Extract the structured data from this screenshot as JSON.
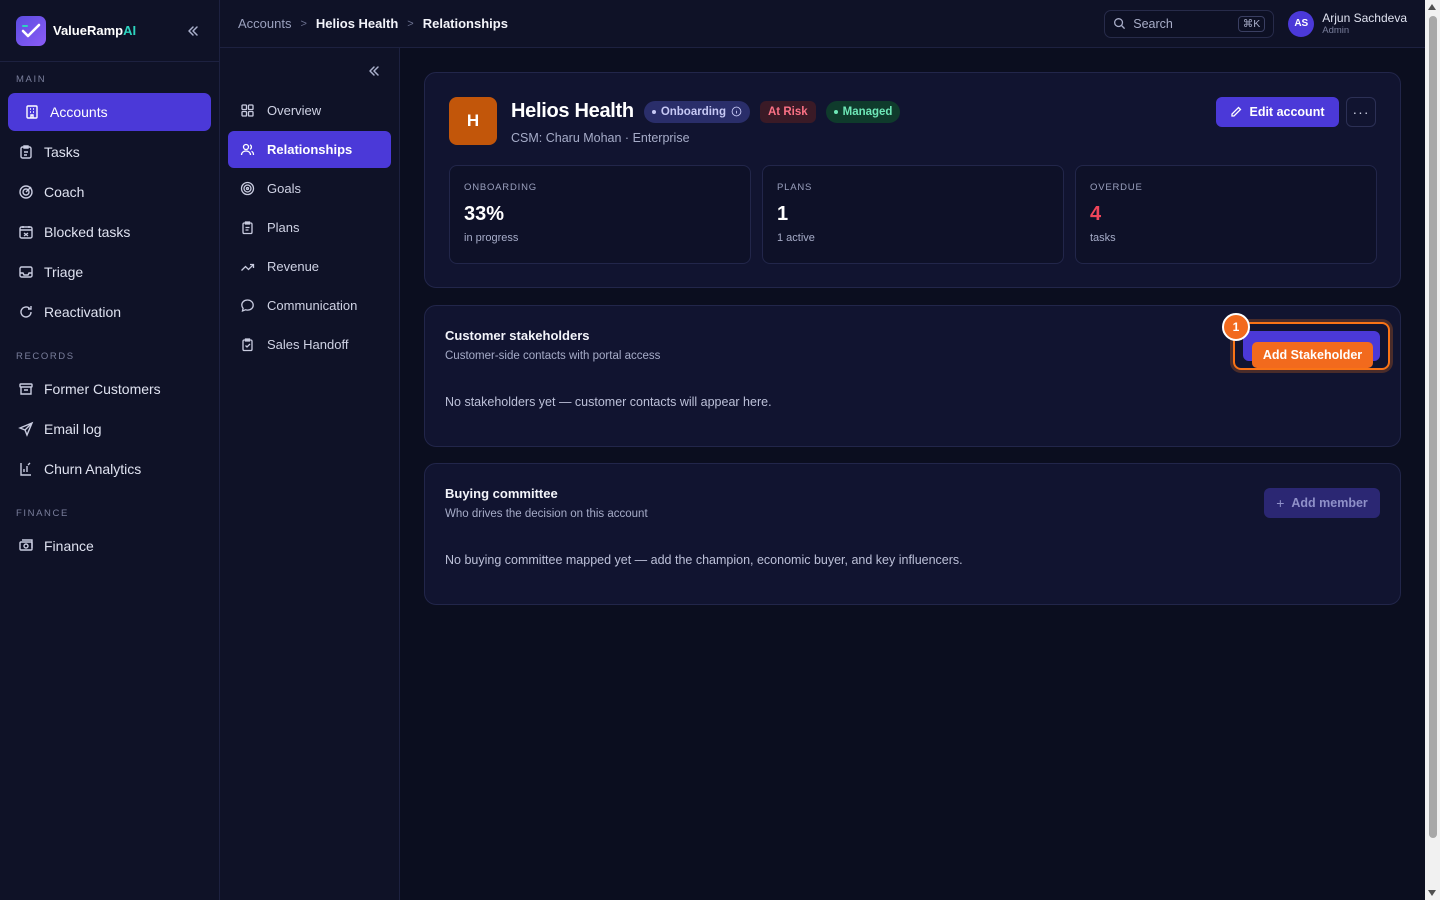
{
  "brand": {
    "name": "ValueRamp",
    "suffix": "AI"
  },
  "sidebar": {
    "sections": [
      {
        "label": "MAIN",
        "items": [
          {
            "label": "Accounts",
            "icon": "building-icon",
            "active": true
          },
          {
            "label": "Tasks",
            "icon": "clipboard-icon"
          },
          {
            "label": "Coach",
            "icon": "target-icon"
          },
          {
            "label": "Blocked tasks",
            "icon": "calendar-x-icon"
          },
          {
            "label": "Triage",
            "icon": "inbox-icon"
          },
          {
            "label": "Reactivation",
            "icon": "refresh-icon"
          }
        ]
      },
      {
        "label": "RECORDS",
        "items": [
          {
            "label": "Former Customers",
            "icon": "archive-icon"
          },
          {
            "label": "Email log",
            "icon": "send-icon"
          },
          {
            "label": "Churn Analytics",
            "icon": "chart-icon"
          }
        ]
      },
      {
        "label": "FINANCE",
        "items": [
          {
            "label": "Finance",
            "icon": "banknote-icon"
          }
        ]
      }
    ]
  },
  "breadcrumb": [
    "Accounts",
    "Helios Health",
    "Relationships"
  ],
  "search": {
    "placeholder": "Search",
    "shortcut": "⌘K"
  },
  "user": {
    "initials": "AS",
    "name": "Arjun Sachdeva",
    "role": "Admin"
  },
  "subnav": {
    "items": [
      {
        "label": "Overview",
        "icon": "grid-icon"
      },
      {
        "label": "Relationships",
        "icon": "users-icon",
        "active": true
      },
      {
        "label": "Goals",
        "icon": "target-icon"
      },
      {
        "label": "Plans",
        "icon": "clipboard-icon"
      },
      {
        "label": "Revenue",
        "icon": "trending-up-icon"
      },
      {
        "label": "Communication",
        "icon": "message-icon"
      },
      {
        "label": "Sales Handoff",
        "icon": "clipboard-check-icon"
      }
    ]
  },
  "account": {
    "initial": "H",
    "name": "Helios Health",
    "badges": {
      "onboarding": "Onboarding",
      "risk": "At Risk",
      "managed": "Managed"
    },
    "subtitle": "CSM: Charu Mohan · Enterprise",
    "edit_label": "Edit account",
    "more_label": "···",
    "stats": [
      {
        "label": "ONBOARDING",
        "value": "33%",
        "caption": "in progress"
      },
      {
        "label": "PLANS",
        "value": "1",
        "caption": "1 active"
      },
      {
        "label": "OVERDUE",
        "value": "4",
        "caption": "tasks"
      }
    ]
  },
  "stakeholders": {
    "title": "Customer stakeholders",
    "subtitle": "Customer-side contacts with portal access",
    "button_label": "Add Stakeholder",
    "marker": "1",
    "empty": "No stakeholders yet — customer contacts will appear here."
  },
  "buying_committee": {
    "title": "Buying committee",
    "subtitle": "Who drives the decision on this account",
    "button_label": "Add member",
    "button_icon": "+",
    "empty": "No buying committee mapped yet — add the champion, economic buyer, and key influencers."
  },
  "colors": {
    "accent": "#4b39d8",
    "highlight": "#f26a1d",
    "danger": "#f0455a",
    "success": "#6ee7b7"
  }
}
